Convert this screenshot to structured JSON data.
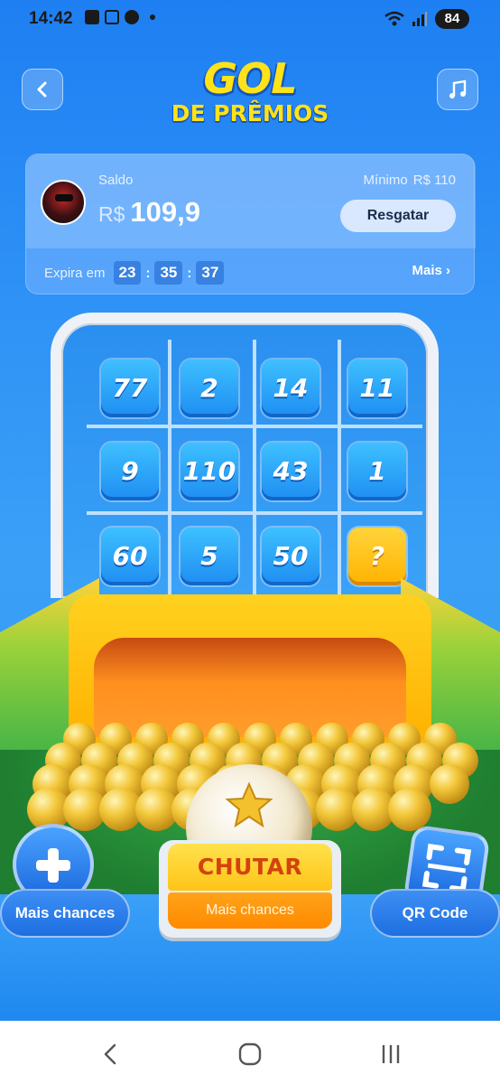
{
  "status_bar": {
    "time": "14:42",
    "battery": "84",
    "icons": [
      "chat-icon",
      "screenshot-icon",
      "soccer-icon",
      "dot-icon",
      "wifi-icon",
      "signal-icon",
      "battery-icon"
    ]
  },
  "header": {
    "title_line1": "GOL",
    "title_line2": "DE PRÊMIOS",
    "back_icon": "chevron-left-icon",
    "music_icon": "music-note-icon",
    "title_color": "#ffe21a"
  },
  "balance": {
    "label": "Saldo",
    "currency": "R$",
    "amount": "109,9",
    "minimum_label": "Mínimo",
    "minimum_value": "R$ 110",
    "redeem_label": "Resgatar",
    "expires_label": "Expira em",
    "time_h": "23",
    "time_m": "35",
    "time_s": "37",
    "more_label": "Mais ›"
  },
  "goal": {
    "tiles": [
      [
        "77",
        "2",
        "14",
        "11"
      ],
      [
        "9",
        "110",
        "43",
        "1"
      ],
      [
        "60",
        "5",
        "50",
        "?"
      ]
    ]
  },
  "controls": {
    "kick_label": "CHUTAR",
    "kick_sublabel": "Mais chances",
    "more_chances_label": "Mais chances",
    "qr_label": "QR Code",
    "accent_yellow": "#ffc417",
    "accent_orange": "#ff8a00",
    "accent_blue": "#1e6fe0"
  },
  "nav_bar": {
    "items": [
      "back-nav-icon",
      "home-nav-icon",
      "recents-nav-icon"
    ]
  }
}
